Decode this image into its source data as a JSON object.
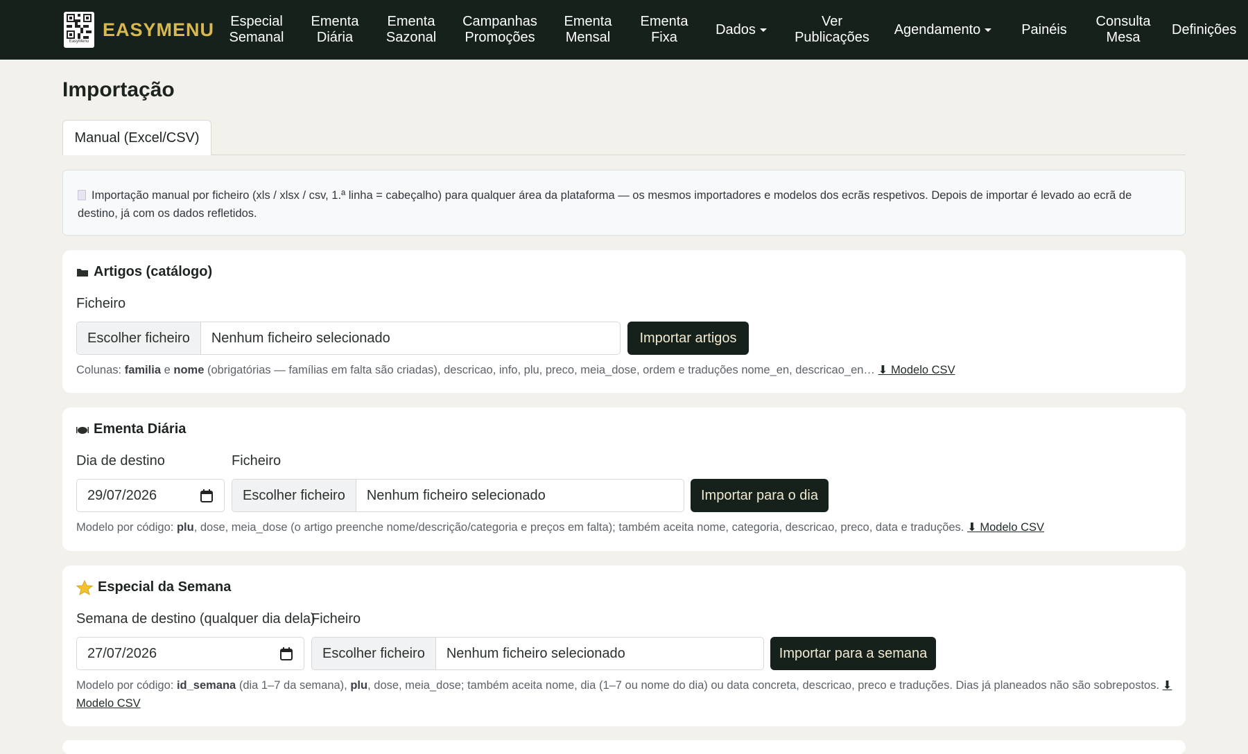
{
  "app": {
    "brand": "EASYMENU",
    "qr_caption": "EasyMenu",
    "accent_color": "#d8b94f",
    "nav_bg": "#16211b"
  },
  "nav": [
    {
      "line1": "Especial",
      "line2": "Semanal"
    },
    {
      "line1": "Ementa",
      "line2": "Diária"
    },
    {
      "line1": "Ementa",
      "line2": "Sazonal"
    },
    {
      "line1": "Campanhas",
      "line2": "Promoções"
    },
    {
      "line1": "Ementa",
      "line2": "Mensal"
    },
    {
      "line1": "Ementa",
      "line2": "Fixa"
    },
    {
      "label": "Dados",
      "dropdown": true
    },
    {
      "line1": "Ver",
      "line2": "Publicações"
    },
    {
      "label": "Agendamento",
      "dropdown": true
    },
    {
      "label": "Painéis"
    },
    {
      "line1": "Consulta",
      "line2": "Mesa"
    },
    {
      "label": "Definições"
    }
  ],
  "page": {
    "title": "Importação",
    "tab_active": "Manual (Excel/CSV)",
    "info_text": "Importação manual por ficheiro (xls / xlsx / csv, 1.ª linha = cabeçalho) para qualquer área da plataforma — os mesmos importadores e modelos dos ecrãs respetivos. Depois de importar é levado ao ecrã de destino, já com os dados refletidos.",
    "info_icon": "document-icon"
  },
  "common": {
    "file_label": "Ficheiro",
    "choose_file": "Escolher ficheiro",
    "no_file": "Nenhum ficheiro selecionado",
    "template_link": "⬇ Modelo CSV"
  },
  "artigos": {
    "icon": "folder-icon",
    "title": "Artigos (catálogo)",
    "button": "Importar artigos",
    "help_prefix": "Colunas: ",
    "help_b1": "familia",
    "help_mid1": " e ",
    "help_b2": "nome",
    "help_rest": " (obrigatórias — famílias em falta são criadas), descricao, info, plu, preco, meia_dose, ordem e traduções nome_en, descricao_en… "
  },
  "ementa_diaria": {
    "icon": "plate-icon",
    "title": "Ementa Diária",
    "date_label": "Dia de destino",
    "date_value": "29/07/2026",
    "button": "Importar para o dia",
    "help_prefix": "Modelo por código: ",
    "help_b1": "plu",
    "help_rest": ", dose, meia_dose (o artigo preenche nome/descrição/categoria e preços em falta); também aceita nome, categoria, descricao, preco, data e traduções. "
  },
  "especial_semana": {
    "icon": "star-icon",
    "title": "Especial da Semana",
    "date_label": "Semana de destino (qualquer dia dela)",
    "date_value": "27/07/2026",
    "button": "Importar para a semana",
    "help_prefix": "Modelo por código: ",
    "help_b1": "id_semana",
    "help_mid1": " (dia 1–7 da semana), ",
    "help_b2": "plu",
    "help_rest": ", dose, meia_dose; também aceita nome, dia (1–7 ou nome do dia) ou data concreta, descricao, preco e traduções. Dias já planeados não são sobrepostos. "
  }
}
